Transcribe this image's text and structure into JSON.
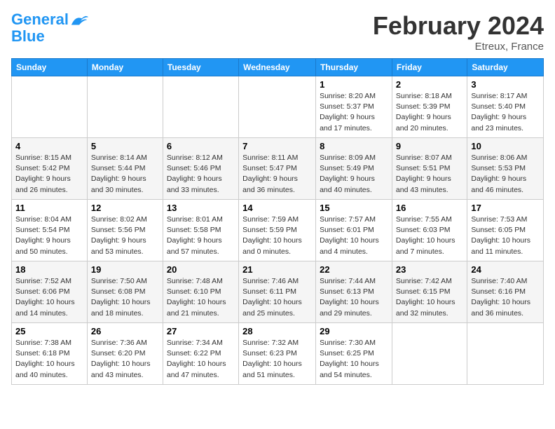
{
  "header": {
    "logo_line1": "General",
    "logo_line2": "Blue",
    "month": "February 2024",
    "location": "Etreux, France"
  },
  "days_of_week": [
    "Sunday",
    "Monday",
    "Tuesday",
    "Wednesday",
    "Thursday",
    "Friday",
    "Saturday"
  ],
  "weeks": [
    [
      {
        "num": "",
        "info": ""
      },
      {
        "num": "",
        "info": ""
      },
      {
        "num": "",
        "info": ""
      },
      {
        "num": "",
        "info": ""
      },
      {
        "num": "1",
        "info": "Sunrise: 8:20 AM\nSunset: 5:37 PM\nDaylight: 9 hours\nand 17 minutes."
      },
      {
        "num": "2",
        "info": "Sunrise: 8:18 AM\nSunset: 5:39 PM\nDaylight: 9 hours\nand 20 minutes."
      },
      {
        "num": "3",
        "info": "Sunrise: 8:17 AM\nSunset: 5:40 PM\nDaylight: 9 hours\nand 23 minutes."
      }
    ],
    [
      {
        "num": "4",
        "info": "Sunrise: 8:15 AM\nSunset: 5:42 PM\nDaylight: 9 hours\nand 26 minutes."
      },
      {
        "num": "5",
        "info": "Sunrise: 8:14 AM\nSunset: 5:44 PM\nDaylight: 9 hours\nand 30 minutes."
      },
      {
        "num": "6",
        "info": "Sunrise: 8:12 AM\nSunset: 5:46 PM\nDaylight: 9 hours\nand 33 minutes."
      },
      {
        "num": "7",
        "info": "Sunrise: 8:11 AM\nSunset: 5:47 PM\nDaylight: 9 hours\nand 36 minutes."
      },
      {
        "num": "8",
        "info": "Sunrise: 8:09 AM\nSunset: 5:49 PM\nDaylight: 9 hours\nand 40 minutes."
      },
      {
        "num": "9",
        "info": "Sunrise: 8:07 AM\nSunset: 5:51 PM\nDaylight: 9 hours\nand 43 minutes."
      },
      {
        "num": "10",
        "info": "Sunrise: 8:06 AM\nSunset: 5:53 PM\nDaylight: 9 hours\nand 46 minutes."
      }
    ],
    [
      {
        "num": "11",
        "info": "Sunrise: 8:04 AM\nSunset: 5:54 PM\nDaylight: 9 hours\nand 50 minutes."
      },
      {
        "num": "12",
        "info": "Sunrise: 8:02 AM\nSunset: 5:56 PM\nDaylight: 9 hours\nand 53 minutes."
      },
      {
        "num": "13",
        "info": "Sunrise: 8:01 AM\nSunset: 5:58 PM\nDaylight: 9 hours\nand 57 minutes."
      },
      {
        "num": "14",
        "info": "Sunrise: 7:59 AM\nSunset: 5:59 PM\nDaylight: 10 hours\nand 0 minutes."
      },
      {
        "num": "15",
        "info": "Sunrise: 7:57 AM\nSunset: 6:01 PM\nDaylight: 10 hours\nand 4 minutes."
      },
      {
        "num": "16",
        "info": "Sunrise: 7:55 AM\nSunset: 6:03 PM\nDaylight: 10 hours\nand 7 minutes."
      },
      {
        "num": "17",
        "info": "Sunrise: 7:53 AM\nSunset: 6:05 PM\nDaylight: 10 hours\nand 11 minutes."
      }
    ],
    [
      {
        "num": "18",
        "info": "Sunrise: 7:52 AM\nSunset: 6:06 PM\nDaylight: 10 hours\nand 14 minutes."
      },
      {
        "num": "19",
        "info": "Sunrise: 7:50 AM\nSunset: 6:08 PM\nDaylight: 10 hours\nand 18 minutes."
      },
      {
        "num": "20",
        "info": "Sunrise: 7:48 AM\nSunset: 6:10 PM\nDaylight: 10 hours\nand 21 minutes."
      },
      {
        "num": "21",
        "info": "Sunrise: 7:46 AM\nSunset: 6:11 PM\nDaylight: 10 hours\nand 25 minutes."
      },
      {
        "num": "22",
        "info": "Sunrise: 7:44 AM\nSunset: 6:13 PM\nDaylight: 10 hours\nand 29 minutes."
      },
      {
        "num": "23",
        "info": "Sunrise: 7:42 AM\nSunset: 6:15 PM\nDaylight: 10 hours\nand 32 minutes."
      },
      {
        "num": "24",
        "info": "Sunrise: 7:40 AM\nSunset: 6:16 PM\nDaylight: 10 hours\nand 36 minutes."
      }
    ],
    [
      {
        "num": "25",
        "info": "Sunrise: 7:38 AM\nSunset: 6:18 PM\nDaylight: 10 hours\nand 40 minutes."
      },
      {
        "num": "26",
        "info": "Sunrise: 7:36 AM\nSunset: 6:20 PM\nDaylight: 10 hours\nand 43 minutes."
      },
      {
        "num": "27",
        "info": "Sunrise: 7:34 AM\nSunset: 6:22 PM\nDaylight: 10 hours\nand 47 minutes."
      },
      {
        "num": "28",
        "info": "Sunrise: 7:32 AM\nSunset: 6:23 PM\nDaylight: 10 hours\nand 51 minutes."
      },
      {
        "num": "29",
        "info": "Sunrise: 7:30 AM\nSunset: 6:25 PM\nDaylight: 10 hours\nand 54 minutes."
      },
      {
        "num": "",
        "info": ""
      },
      {
        "num": "",
        "info": ""
      }
    ]
  ]
}
